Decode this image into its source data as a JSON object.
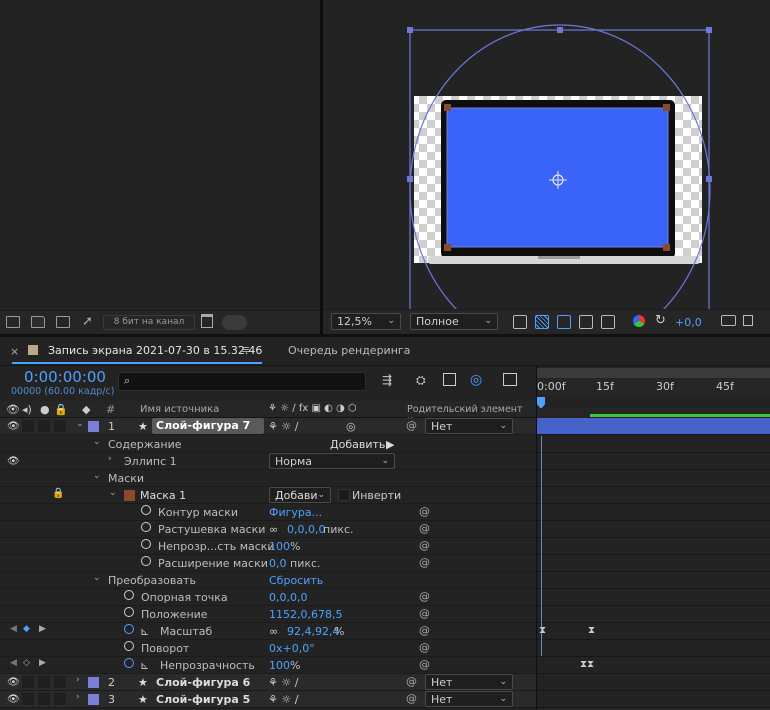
{
  "project_panel": {
    "bit_depth": "8 бит на канал"
  },
  "viewer": {
    "zoom": "12,5%",
    "resolution": "Полное",
    "exposure": "+0,0"
  },
  "tabs": {
    "comp_tab": "Запись экрана 2021-07-30 в 15.32.46",
    "render_queue": "Очередь рендеринга"
  },
  "timeline": {
    "timecode": "0:00:00:00",
    "frame_info": "00000 (60.00 кадр/с)",
    "search_placeholder": "",
    "ruler": [
      "0:00f",
      "15f",
      "30f",
      "45f"
    ],
    "headers": {
      "hash": "#",
      "source_name": "Имя источника",
      "parent": "Родительский элемент и..."
    },
    "layer1": {
      "index": "1",
      "name": "Слой-фигура 7",
      "parent": "Нет"
    },
    "contents": {
      "label": "Содержание",
      "add": "Добавить:"
    },
    "ellipse": {
      "label": "Эллипс 1",
      "mode": "Норма"
    },
    "masks": {
      "label": "Маски"
    },
    "mask1": {
      "label": "Маска 1",
      "mode": "Добави",
      "invert": "Инверти"
    },
    "mask_path": {
      "label": "Контур маски",
      "value": "Фигура..."
    },
    "mask_feather": {
      "label": "Растушевка маски",
      "value": "0,0,0,0",
      "unit": "пикс."
    },
    "mask_opacity": {
      "label": "Непрозр...сть маски",
      "value": "100",
      "unit": "%"
    },
    "mask_expansion": {
      "label": "Расширение маски",
      "value": "0,0",
      "unit": "пикс."
    },
    "transform": {
      "label": "Преобразовать",
      "reset": "Сбросить"
    },
    "anchor": {
      "label": "Опорная точка",
      "value": "0,0,0,0"
    },
    "position": {
      "label": "Положение",
      "value": "1152,0,678,5"
    },
    "scale": {
      "label": "Масштаб",
      "value": "92,4,92,4",
      "unit": "%"
    },
    "rotation": {
      "label": "Поворот",
      "value": "0x+0,0°"
    },
    "opacity": {
      "label": "Непрозрачность",
      "value": "100",
      "unit": "%"
    },
    "layer6": {
      "index": "2",
      "name": "Слой-фигура 6",
      "parent": "Нет"
    },
    "layer5": {
      "index": "3",
      "name": "Слой-фигура 5",
      "parent": "Нет"
    }
  },
  "colors": {
    "accent_blue": "#4ea1ff",
    "comp_blue": "#3a63f7",
    "layer_label": "#7a7fd6",
    "mask_label": "#8a4a2e"
  }
}
